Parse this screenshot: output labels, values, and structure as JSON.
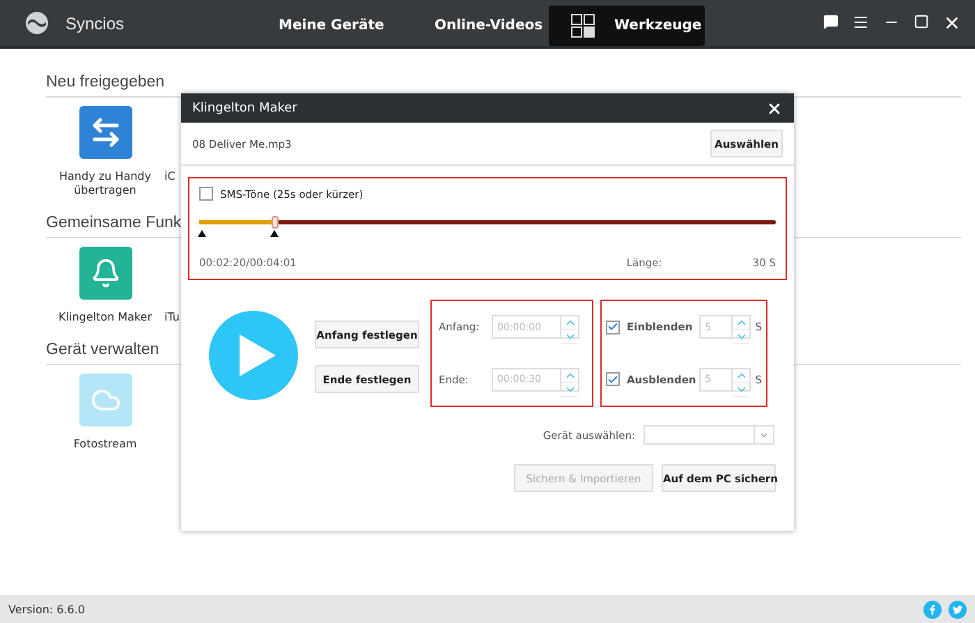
{
  "app": {
    "name": "Syncios"
  },
  "nav_tabs": [
    {
      "label": "Meine Geräte",
      "selected": false
    },
    {
      "label": "Online-Videos",
      "selected": false
    },
    {
      "label": "Werkzeuge",
      "selected": true
    }
  ],
  "sections": [
    {
      "title": "Neu freigegeben",
      "items": [
        {
          "label": "Handy zu Handy übertragen",
          "color": "#2f83d6"
        },
        {
          "label": "iC"
        }
      ]
    },
    {
      "title": "Gemeinsame Funk",
      "items": [
        {
          "label": "Klingelton Maker",
          "color": "#23b397"
        },
        {
          "label": "iTu"
        }
      ]
    },
    {
      "title": "Gerät verwalten",
      "items": [
        {
          "label": "Fotostream",
          "color": "#b5e6f7"
        }
      ]
    }
  ],
  "dialog": {
    "title": "Klingelton Maker",
    "file": "08 Deliver Me.mp3",
    "choose_button": "Auswählen",
    "sms": {
      "label": "SMS-Töne (25s oder kürzer)",
      "checked": false
    },
    "slider": {
      "level": 0.13
    },
    "position": "00:02:20/00:04:01",
    "length_label": "Länge:",
    "length_value": "30 S",
    "set_buttons": [
      "Anfang festlegen",
      "Ende festlegen"
    ],
    "times": [
      {
        "label": "Anfang:",
        "value": "00:00:00"
      },
      {
        "label": "Ende:",
        "value": "00:00:30"
      }
    ],
    "fades": [
      {
        "label": "Einblenden",
        "checked": true,
        "value": "5",
        "unit": "S"
      },
      {
        "label": "Ausblenden",
        "checked": true,
        "value": "5",
        "unit": "S"
      }
    ],
    "device_label": "Gerät auswählen:",
    "actions": [
      {
        "label": "Sichern & Importieren",
        "disabled": true
      },
      {
        "label": "Auf dem PC sichern",
        "disabled": false
      }
    ]
  },
  "status_bar": {
    "version": "Version: 6.6.0"
  }
}
